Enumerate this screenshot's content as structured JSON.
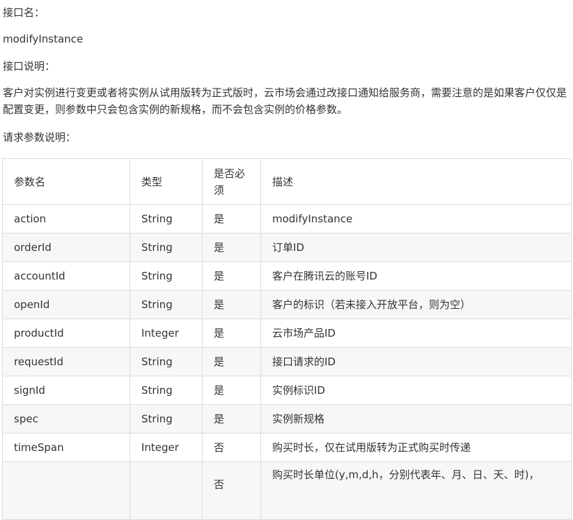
{
  "doc": {
    "api_name_label": "接口名：",
    "api_name": "modifyInstance",
    "api_desc_label": "接口说明：",
    "api_desc": "客户对实例进行变更或者将实例从试用版转为正式版时，云市场会通过改接口通知给服务商，需要注意的是如果客户仅仅是配置变更，则参数中只会包含实例的新规格，而不会包含实例的价格参数。",
    "params_label": "请求参数说明："
  },
  "table": {
    "headers": [
      "参数名",
      "类型",
      "是否必须",
      "描述"
    ],
    "rows": [
      [
        "action",
        "String",
        "是",
        "modifyInstance"
      ],
      [
        "orderId",
        "String",
        "是",
        "订单ID"
      ],
      [
        "accountId",
        "String",
        "是",
        "客户在腾讯云的账号ID"
      ],
      [
        "openId",
        "String",
        "是",
        "客户的标识（若未接入开放平台，则为空）"
      ],
      [
        "productId",
        "Integer",
        "是",
        "云市场产品ID"
      ],
      [
        "requestId",
        "String",
        "是",
        "接口请求的ID"
      ],
      [
        "signId",
        "String",
        "是",
        "实例标识ID"
      ],
      [
        "spec",
        "String",
        "是",
        "实例新规格"
      ],
      [
        "timeSpan",
        "Integer",
        "否",
        "购买时长，仅在试用版转为正式购买时传递"
      ],
      [
        "",
        "",
        "否",
        "购买时长单位(y,m,d,h，分别代表年、月、日、天、时)，"
      ]
    ]
  }
}
